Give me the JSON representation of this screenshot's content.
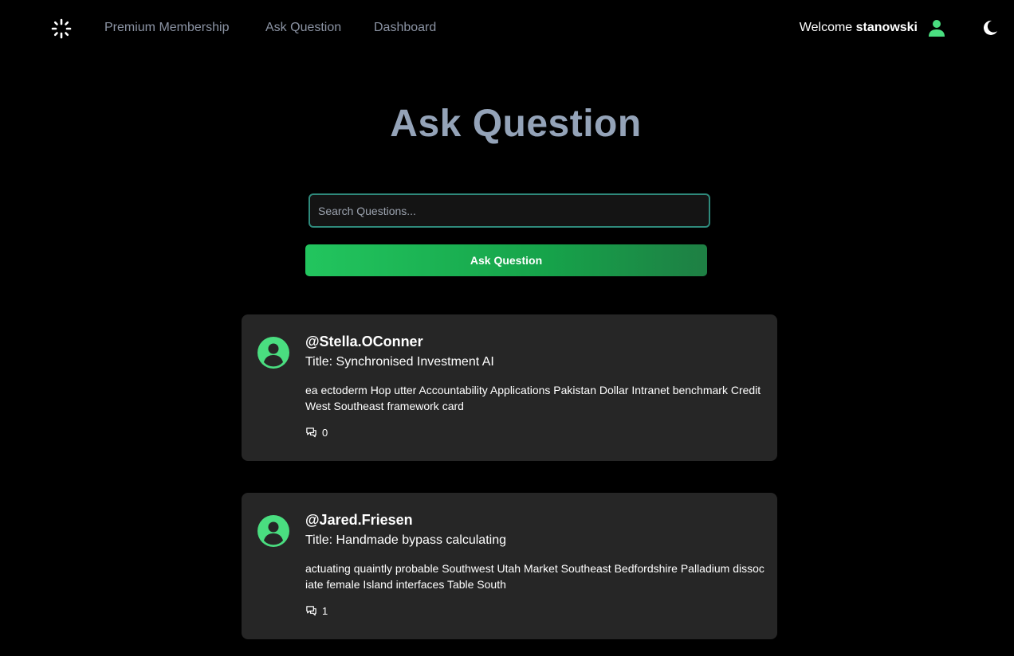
{
  "nav": {
    "logo_icon": "sparkle-logo-icon",
    "links": [
      {
        "label": "Premium Membership"
      },
      {
        "label": "Ask Question"
      },
      {
        "label": "Dashboard"
      }
    ],
    "welcome_prefix": "Welcome",
    "username": "stanowski",
    "user_icon": "user-icon",
    "theme_icon": "moon-icon",
    "accent_color": "#4ade80"
  },
  "page": {
    "title": "Ask Question"
  },
  "search": {
    "placeholder": "Search Questions...",
    "value": ""
  },
  "ask_button": {
    "label": "Ask Question"
  },
  "questions": [
    {
      "author": "@Stella.OConner",
      "title": "Title: Synchronised Investment AI",
      "body": "ea ectoderm Hop utter Accountability Applications Pakistan Dollar Intranet benchmark Credit West Southeast framework card",
      "comment_count": "0",
      "comment_icon": "comments-icon"
    },
    {
      "author": "@Jared.Friesen",
      "title": "Title: Handmade bypass calculating",
      "body": "actuating quaintly probable Southwest Utah Market Southeast Bedfordshire Palladium dissociate female Island interfaces Table South",
      "comment_count": "1",
      "comment_icon": "comments-icon"
    }
  ]
}
